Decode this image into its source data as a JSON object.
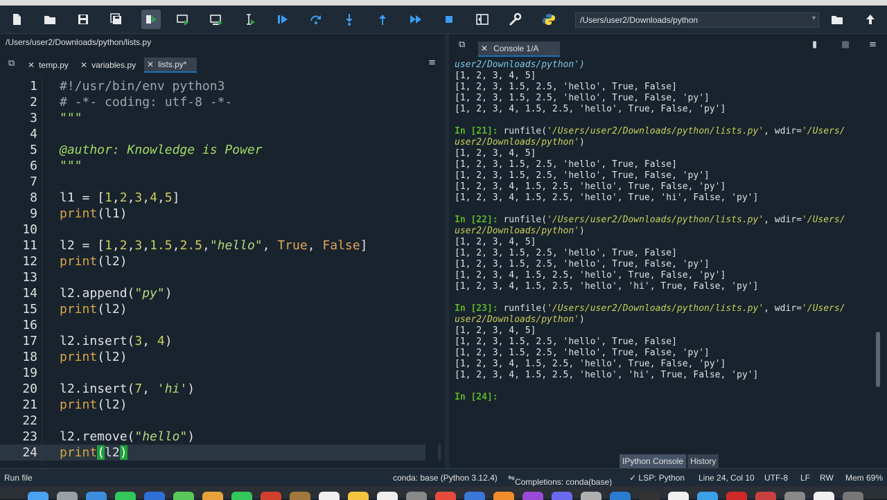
{
  "toolbar": {
    "buttons": [
      "new-file",
      "open-file",
      "save",
      "save-all",
      "run-file",
      "run-cell",
      "run-cell-advance",
      "run-selection",
      "debug",
      "step",
      "step-into",
      "step-return",
      "continue",
      "stop",
      "maximize-pane",
      "preferences",
      "python-path"
    ],
    "working_dir": "/Users/user2/Downloads/python"
  },
  "editor": {
    "file_path": "/Users/user2/Downloads/python/lists.py",
    "tabs": [
      {
        "label": "temp.py"
      },
      {
        "label": "variables.py"
      },
      {
        "label": "lists.py*"
      }
    ],
    "lines": [
      {
        "n": "1",
        "text": "#!/usr/bin/env python3"
      },
      {
        "n": "2",
        "text": "# -*- coding: utf-8 -*-"
      },
      {
        "n": "3",
        "text": "\"\"\""
      },
      {
        "n": "4",
        "text": ""
      },
      {
        "n": "5",
        "text": "@author: Knowledge is Power"
      },
      {
        "n": "6",
        "text": "\"\"\""
      },
      {
        "n": "7",
        "text": ""
      },
      {
        "n": "8",
        "text": "l1 = [1,2,3,4,5]"
      },
      {
        "n": "9",
        "text": "print(l1)"
      },
      {
        "n": "10",
        "text": ""
      },
      {
        "n": "11",
        "text": "l2 = [1,2,3,1.5,2.5,\"hello\", True, False]"
      },
      {
        "n": "12",
        "text": "print(l2)"
      },
      {
        "n": "13",
        "text": ""
      },
      {
        "n": "14",
        "text": "l2.append(\"py\")"
      },
      {
        "n": "15",
        "text": "print(l2)"
      },
      {
        "n": "16",
        "text": ""
      },
      {
        "n": "17",
        "text": "l2.insert(3, 4)"
      },
      {
        "n": "18",
        "text": "print(l2)"
      },
      {
        "n": "19",
        "text": ""
      },
      {
        "n": "20",
        "text": "l2.insert(7, 'hi')"
      },
      {
        "n": "21",
        "text": "print(l2)"
      },
      {
        "n": "22",
        "text": ""
      },
      {
        "n": "23",
        "text": "l2.remove(\"hello\")"
      },
      {
        "n": "24",
        "text": "print(l2)"
      }
    ]
  },
  "console": {
    "tab_label": "Console 1/A",
    "bottom_tabs": [
      "IPython Console",
      "History"
    ],
    "path_cont": "user2/Downloads/python')",
    "out_21_prev": [
      "[1, 2, 3, 4, 5]",
      "[1, 2, 3, 1.5, 2.5, 'hello', True, False]",
      "[1, 2, 3, 1.5, 2.5, 'hello', True, False, 'py']",
      "[1, 2, 3, 4, 1.5, 2.5, 'hello', True, False, 'py']"
    ],
    "blocks": [
      {
        "prompt": "In [21]:",
        "cmd": " runfile(",
        "file": "'/Users/user2/Downloads/python/lists.py'",
        "wdir": ", wdir=",
        "wdir_val": "'/Users/",
        "cont": "user2/Downloads/python'",
        "close": ")",
        "out": [
          "[1, 2, 3, 4, 5]",
          "[1, 2, 3, 1.5, 2.5, 'hello', True, False]",
          "[1, 2, 3, 1.5, 2.5, 'hello', True, False, 'py']",
          "[1, 2, 3, 4, 1.5, 2.5, 'hello', True, False, 'py']",
          "[1, 2, 3, 4, 1.5, 2.5, 'hello', True, 'hi', False, 'py']"
        ]
      },
      {
        "prompt": "In [22]:",
        "cmd": " runfile(",
        "file": "'/Users/user2/Downloads/python/lists.py'",
        "wdir": ", wdir=",
        "wdir_val": "'/Users/",
        "cont": "user2/Downloads/python'",
        "close": ")",
        "out": [
          "[1, 2, 3, 4, 5]",
          "[1, 2, 3, 1.5, 2.5, 'hello', True, False]",
          "[1, 2, 3, 1.5, 2.5, 'hello', True, False, 'py']",
          "[1, 2, 3, 4, 1.5, 2.5, 'hello', True, False, 'py']",
          "[1, 2, 3, 4, 1.5, 2.5, 'hello', 'hi', True, False, 'py']"
        ]
      },
      {
        "prompt": "In [23]:",
        "cmd": " runfile(",
        "file": "'/Users/user2/Downloads/python/lists.py'",
        "wdir": ", wdir=",
        "wdir_val": "'/Users/",
        "cont": "user2/Downloads/python'",
        "close": ")",
        "out": [
          "[1, 2, 3, 4, 5]",
          "[1, 2, 3, 1.5, 2.5, 'hello', True, False]",
          "[1, 2, 3, 1.5, 2.5, 'hello', True, False, 'py']",
          "[1, 2, 3, 4, 1.5, 2.5, 'hello', True, False, 'py']",
          "[1, 2, 3, 4, 1.5, 2.5, 'hello', 'hi', True, False, 'py']"
        ]
      }
    ],
    "current_prompt": "In [24]:"
  },
  "status": {
    "left": "Run file",
    "conda": "conda: base (Python 3.12.4)",
    "completions": "Completions: conda(base)",
    "lsp": "✓ LSP: Python",
    "position": "Line 24, Col 10",
    "encoding": "UTF-8",
    "eol": "LF",
    "rw": "RW",
    "mem": "Mem 69%"
  },
  "colors": {
    "background": "#19232d",
    "prompt": "#5ab52b",
    "active_tab_underline": "#1a72bb",
    "bracket_match": "#1fa13b"
  }
}
